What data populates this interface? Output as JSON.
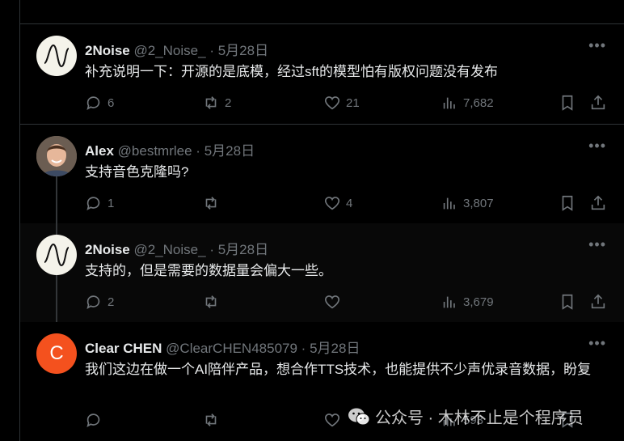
{
  "tweets": [
    {
      "name": "2Noise",
      "handle": "@2_Noise_",
      "date": "5月28日",
      "text": "补充说明一下：开源的是底模，经过sft的模型怕有版权问题没有发布",
      "replies": "6",
      "retweets": "2",
      "likes": "21",
      "views": "7,682"
    },
    {
      "name": "Alex",
      "handle": "@bestmrlee",
      "date": "5月28日",
      "text": "支持音色克隆吗?",
      "replies": "1",
      "retweets": "",
      "likes": "4",
      "views": "3,807"
    },
    {
      "name": "2Noise",
      "handle": "@2_Noise_",
      "date": "5月28日",
      "text": "支持的，但是需要的数据量会偏大一些。",
      "replies": "2",
      "retweets": "",
      "likes": "",
      "views": "3,679"
    },
    {
      "name": "Clear CHEN",
      "handle": "@ClearCHEN485079",
      "date": "5月28日",
      "avatar_letter": "C",
      "text": "我们这边在做一个AI陪伴产品，想合作TTS技术，也能提供不少声优录音数据，盼复",
      "replies": "",
      "retweets": "",
      "likes": "",
      "views": "593"
    }
  ],
  "separator": "·",
  "more_glyph": "•••",
  "watermark": "公众号 · 木林不止是个程序员",
  "colors": {
    "background": "#000000",
    "text": "#e7e9ea",
    "muted": "#71767b",
    "border": "#2f3336",
    "avatar_c": "#f4511e"
  }
}
